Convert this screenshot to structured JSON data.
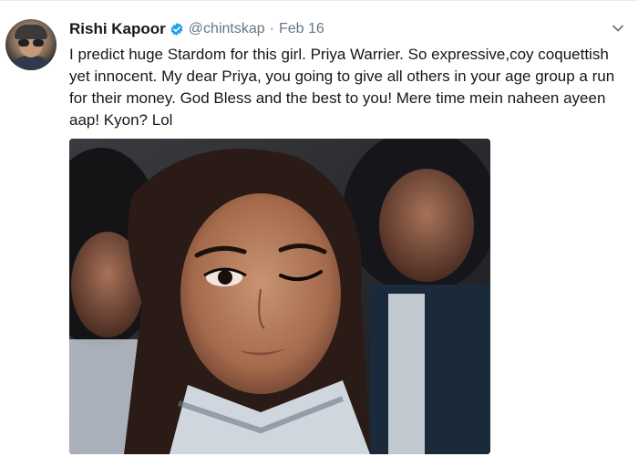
{
  "tweet": {
    "author_name": "Rishi Kapoor",
    "author_handle": "@chintskap",
    "separator": "·",
    "date": "Feb 16",
    "text": "I predict huge Stardom for this girl. Priya Warrier. So expressive,coy coquettish yet innocent. My dear Priya, you going to give all others in your age group a run for their money. God Bless and the best to you! Mere time mein naheen ayeen aap! Kyon? Lol"
  },
  "icons": {
    "verified": "verified-badge-icon",
    "more": "chevron-down-icon"
  },
  "colors": {
    "verified_blue": "#1da1f2",
    "muted_text": "#657786",
    "body_text": "#14171a"
  }
}
